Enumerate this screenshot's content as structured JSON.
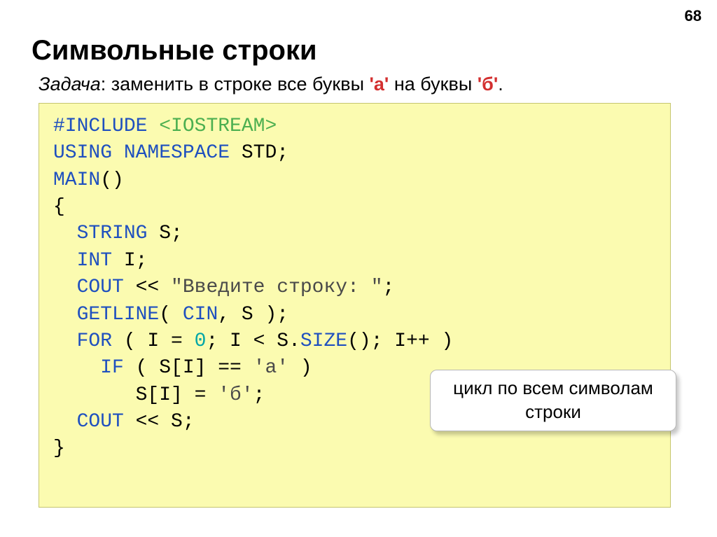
{
  "page_number": "68",
  "title": "Символьные строки",
  "task": {
    "label": "Задача",
    "prefix": ": заменить в строке все буквы ",
    "char1": "'а'",
    "mid": " на буквы ",
    "char2": "'б'",
    "suffix": "."
  },
  "code": {
    "l1a": "#INCLUDE ",
    "l1b": "<IOSTREAM>",
    "l2a": "USING NAMESPACE",
    "l2b": " STD;",
    "l3a": "MAIN",
    "l3b": "()",
    "l4": "{",
    "l5a": "  STRING",
    "l5b": " S;",
    "l6a": "  INT",
    "l6b": " I;",
    "l7a": "  COUT",
    "l7b": " << ",
    "l7c": "\"Введите строку: \"",
    "l7d": ";",
    "l8a": "  GETLINE",
    "l8b": "( ",
    "l8c": "CIN",
    "l8d": ", S );",
    "l9a": "  FOR",
    "l9b": " ( I = ",
    "l9c": "0",
    "l9d": "; I < S.",
    "l9e": "SIZE",
    "l9f": "(); I++ )",
    "l10a": "    IF",
    "l10b": " ( S[I] == ",
    "l10c": "'а'",
    "l10d": " )",
    "l11a": "       S[I] = ",
    "l11b": "'б'",
    "l11c": ";",
    "l12a": "  COUT",
    "l12b": " << S;",
    "l13": "}"
  },
  "callout": "цикл по всем символам строки"
}
